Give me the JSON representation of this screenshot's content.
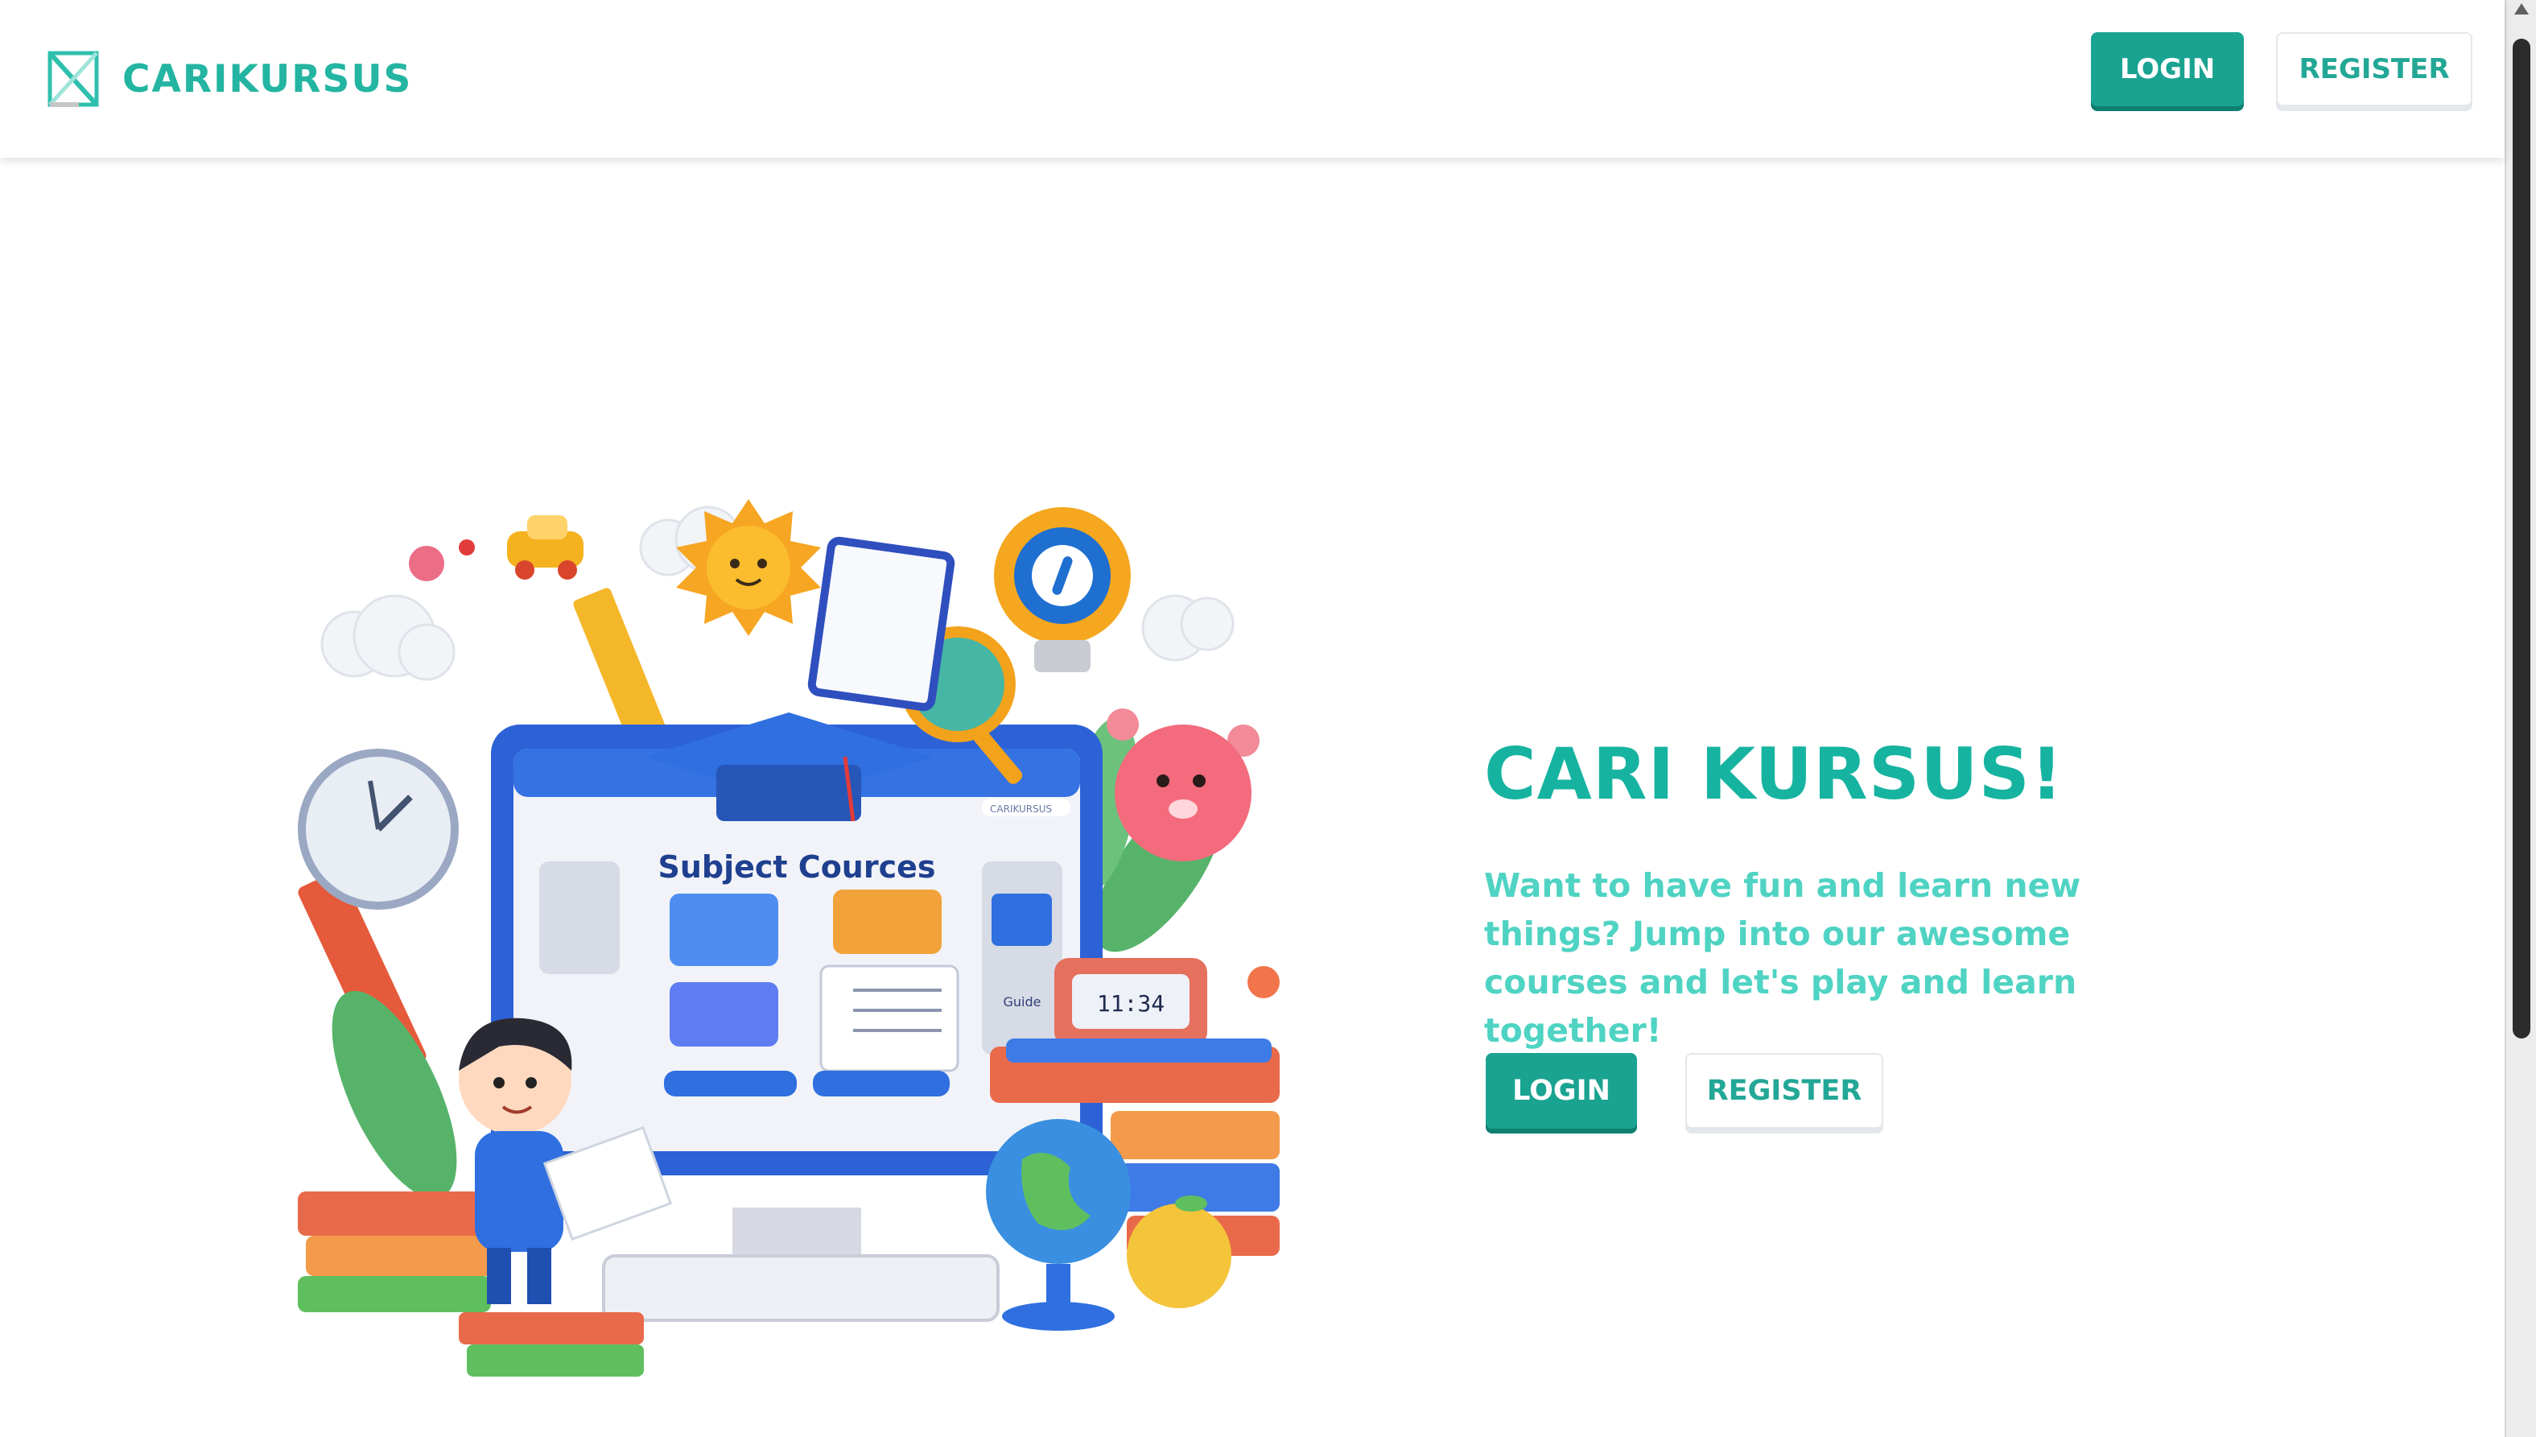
{
  "brand": {
    "name": "CARIKURSUS",
    "logo_icon": "x-logo-icon",
    "color": "#23b5a2"
  },
  "nav": {
    "login_label": "LOGIN",
    "register_label": "REGISTER"
  },
  "hero": {
    "title": "CARI KURSUS!",
    "description": "Want to have fun and learn new things? Jump into our awesome courses and let's play and learn together!",
    "login_label": "LOGIN",
    "register_label": "REGISTER",
    "illustration": {
      "screen_heading": "Subject Cources",
      "search_text": "CARIKURSUS",
      "clock_display": "11:34",
      "side_label": "Guide"
    }
  },
  "colors": {
    "primary": "#1aa391",
    "primary_shadow": "#0f7f70",
    "title": "#16b3a1",
    "text": "#4fd3c3",
    "outline_border": "#e3e7ea"
  }
}
